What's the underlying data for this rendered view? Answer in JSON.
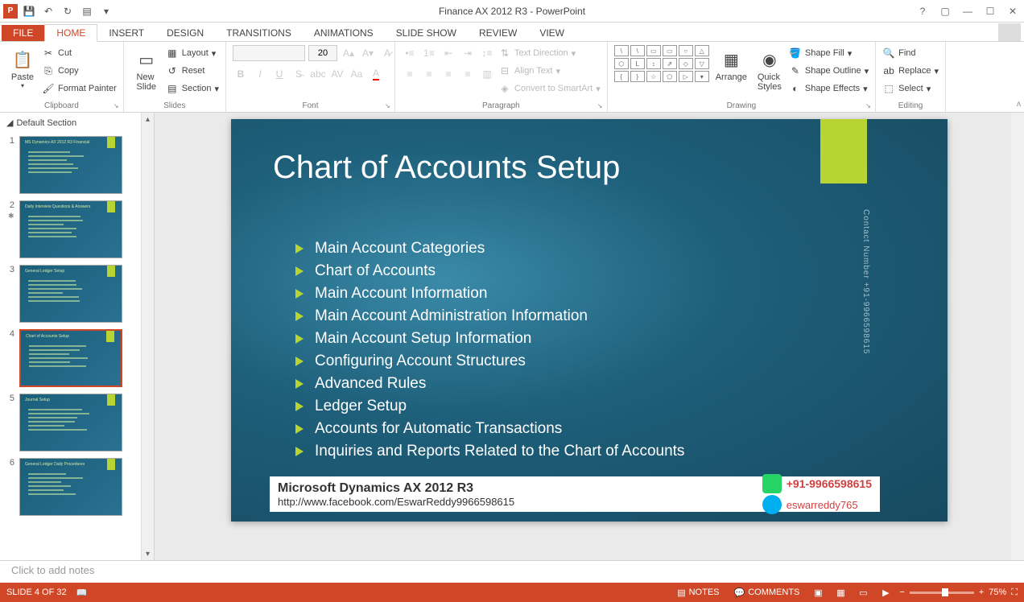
{
  "app": {
    "title": "Finance AX 2012 R3 - PowerPoint"
  },
  "tabs": {
    "file": "FILE",
    "home": "HOME",
    "insert": "INSERT",
    "design": "DESIGN",
    "transitions": "TRANSITIONS",
    "animations": "ANIMATIONS",
    "slideshow": "SLIDE SHOW",
    "review": "REVIEW",
    "view": "VIEW"
  },
  "ribbon": {
    "clipboard": {
      "label": "Clipboard",
      "paste": "Paste",
      "cut": "Cut",
      "copy": "Copy",
      "format_painter": "Format Painter"
    },
    "slides": {
      "label": "Slides",
      "new_slide": "New\nSlide",
      "layout": "Layout",
      "reset": "Reset",
      "section": "Section"
    },
    "font": {
      "label": "Font",
      "size": "20"
    },
    "paragraph": {
      "label": "Paragraph",
      "text_direction": "Text Direction",
      "align_text": "Align Text",
      "convert_smartart": "Convert to SmartArt"
    },
    "drawing": {
      "label": "Drawing",
      "arrange": "Arrange",
      "quick_styles": "Quick\nStyles",
      "shape_fill": "Shape Fill",
      "shape_outline": "Shape Outline",
      "shape_effects": "Shape Effects"
    },
    "editing": {
      "label": "Editing",
      "find": "Find",
      "replace": "Replace",
      "select": "Select"
    }
  },
  "panel": {
    "section": "Default Section",
    "slides": [
      {
        "num": "1",
        "title": "MS Dynamics AX 2012 R3 Financial"
      },
      {
        "num": "2",
        "title": "Daily Interview Questions & Answers",
        "anim": true
      },
      {
        "num": "3",
        "title": "General Ledger Setup"
      },
      {
        "num": "4",
        "title": "Chart of Accounts Setup",
        "selected": true
      },
      {
        "num": "5",
        "title": "Journal Setup"
      },
      {
        "num": "6",
        "title": "General Ledger Daily Procedures"
      }
    ]
  },
  "slide": {
    "title": "Chart of Accounts Setup",
    "bullets": [
      "Main Account Categories",
      "Chart of Accounts",
      "Main Account Information",
      "Main Account Administration Information",
      "Main Account Setup Information",
      "Configuring Account Structures",
      "Advanced Rules",
      "Ledger Setup",
      "Accounts for Automatic Transactions",
      "Inquiries and Reports Related to the Chart of Accounts"
    ],
    "contact_vertical": "Contact Number +91-9966598615",
    "banner": {
      "line1": "Microsoft Dynamics AX 2012 R3",
      "line2": "http://www.facebook.com/EswarReddy9966598615",
      "phone": "+91-9966598615",
      "skype_id": "eswarreddy765"
    }
  },
  "notes": {
    "placeholder": "Click to add notes"
  },
  "status": {
    "slide_info": "SLIDE 4 OF 32",
    "notes": "NOTES",
    "comments": "COMMENTS",
    "zoom": "75%"
  }
}
